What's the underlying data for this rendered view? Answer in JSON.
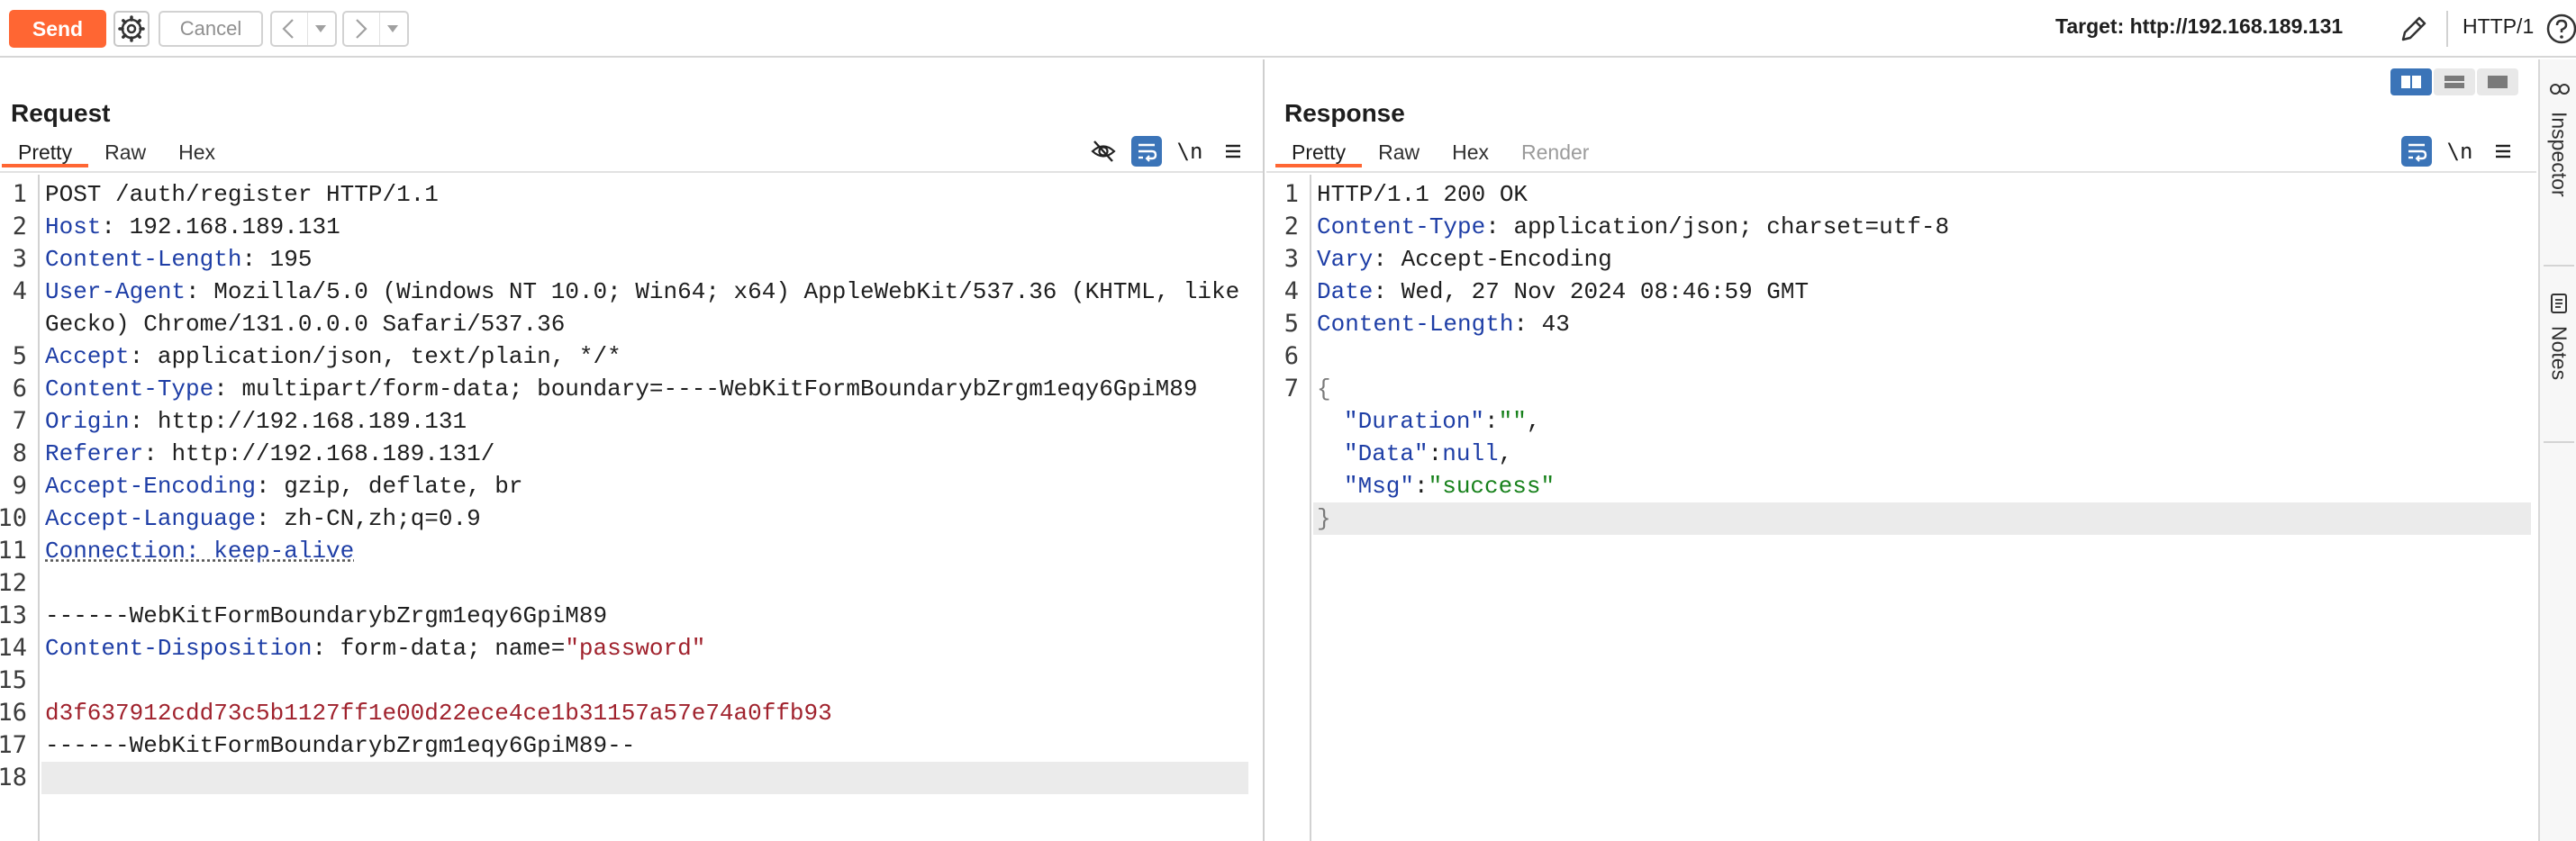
{
  "toolbar": {
    "send_label": "Send",
    "cancel_label": "Cancel",
    "target_label": "Target: http://192.168.189.131",
    "http_version": "HTTP/1"
  },
  "request": {
    "title": "Request",
    "tabs": [
      "Pretty",
      "Raw",
      "Hex"
    ],
    "active_tab": "Pretty",
    "lines": [
      {
        "n": "1",
        "text": "POST /auth/register HTTP/1.1"
      },
      {
        "n": "2",
        "name": "Host",
        "sep": ": ",
        "value": "192.168.189.131"
      },
      {
        "n": "3",
        "name": "Content-Length",
        "sep": ": ",
        "value": "195"
      },
      {
        "n": "4",
        "name": "User-Agent",
        "sep": ": ",
        "value": "Mozilla/5.0 (Windows NT 10.0; Win64; x64) AppleWebKit/537.36 (KHTML, like",
        "cont": "Gecko) Chrome/131.0.0.0 Safari/537.36"
      },
      {
        "n": "5",
        "name": "Accept",
        "sep": ": ",
        "value": "application/json, text/plain, */*"
      },
      {
        "n": "6",
        "name": "Content-Type",
        "sep": ": ",
        "value": "multipart/form-data; boundary=----WebKitFormBoundarybZrgm1eqy6GpiM89"
      },
      {
        "n": "7",
        "name": "Origin",
        "sep": ": ",
        "value": "http://192.168.189.131"
      },
      {
        "n": "8",
        "name": "Referer",
        "sep": ": ",
        "value": "http://192.168.189.131/"
      },
      {
        "n": "9",
        "name": "Accept-Encoding",
        "sep": ": ",
        "value": "gzip, deflate, br"
      },
      {
        "n": "10",
        "name": "Accept-Language",
        "sep": ": ",
        "value": "zh-CN,zh;q=0.9"
      },
      {
        "n": "11",
        "text": "Connection: keep-alive"
      },
      {
        "n": "12",
        "text": ""
      },
      {
        "n": "13",
        "text": "------WebKitFormBoundarybZrgm1eqy6GpiM89"
      },
      {
        "n": "14",
        "name": "Content-Disposition",
        "sep": ": ",
        "value_a": "form-data; name=",
        "value_str": "\"password\""
      },
      {
        "n": "15",
        "text": ""
      },
      {
        "n": "16",
        "text": "d3f637912cdd73c5b1127ff1e00d22ece4ce1b31157a57e74a0ffb93"
      },
      {
        "n": "17",
        "text": "------WebKitFormBoundarybZrgm1eqy6GpiM89--"
      },
      {
        "n": "18",
        "text": ""
      }
    ]
  },
  "response": {
    "title": "Response",
    "tabs": [
      "Pretty",
      "Raw",
      "Hex",
      "Render"
    ],
    "active_tab": "Pretty",
    "lines": [
      {
        "n": "1",
        "text": "HTTP/1.1 200 OK"
      },
      {
        "n": "2",
        "name": "Content-Type",
        "sep": ": ",
        "value": "application/json; charset=utf-8"
      },
      {
        "n": "3",
        "name": "Vary",
        "sep": ": ",
        "value": "Accept-Encoding"
      },
      {
        "n": "4",
        "name": "Date",
        "sep": ": ",
        "value": "Wed, 27 Nov 2024 08:46:59 GMT"
      },
      {
        "n": "5",
        "name": "Content-Length",
        "sep": ": ",
        "value": "43"
      },
      {
        "n": "6",
        "text": ""
      },
      {
        "n": "7",
        "text": "{"
      },
      {
        "key": "\"Duration\"",
        "colon": ":",
        "val": "\"\"",
        "tail": ","
      },
      {
        "key": "\"Data\"",
        "colon": ":",
        "plain": "null",
        "tail": ","
      },
      {
        "key": "\"Msg\"",
        "colon": ":",
        "val": "\"success\""
      },
      {
        "text": "}"
      }
    ]
  },
  "side": {
    "inspector_label": "Inspector",
    "notes_label": "Notes"
  },
  "icons": {
    "settings": "gear-icon",
    "nav_back": "chevron-left-icon",
    "nav_forward": "chevron-right-icon",
    "edit_target": "pencil-icon",
    "help": "question-icon",
    "hide": "eye-slash-icon",
    "wrap": "word-wrap-icon",
    "newline": "\\n",
    "menu": "hamburger-icon"
  },
  "colors": {
    "accent": "#ff6633",
    "toggle_on": "#3b74b8",
    "header_name": "#1e3ea6",
    "string": "#a0222d",
    "json_string": "#17811b"
  }
}
